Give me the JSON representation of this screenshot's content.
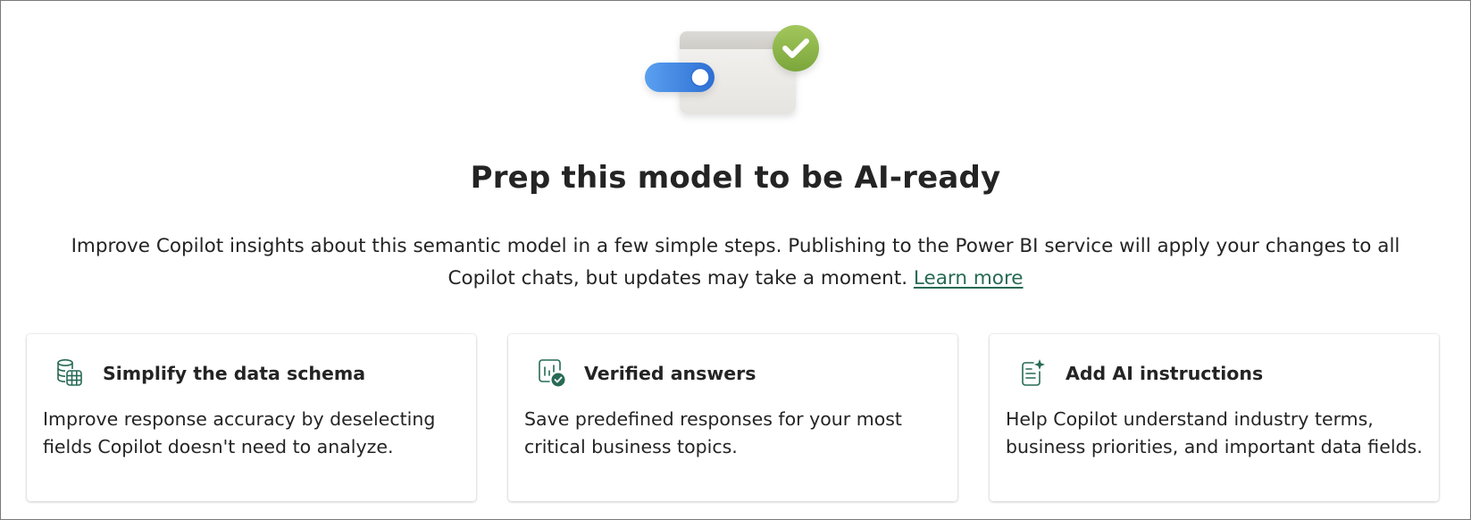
{
  "page": {
    "title": "Prep this model to be AI-ready",
    "description": "Improve Copilot insights about this semantic model in a few simple steps. Publishing to the Power BI service will apply your changes to all Copilot chats, but updates may take a moment.",
    "learn_more": "Learn more"
  },
  "cards": [
    {
      "icon": "table-schema-icon",
      "title": "Simplify the data schema",
      "text": "Improve response accuracy by deselecting fields Copilot doesn't need to analyze."
    },
    {
      "icon": "chart-check-icon",
      "title": "Verified answers",
      "text": "Save predefined responses for your most critical business topics."
    },
    {
      "icon": "document-sparkle-icon",
      "title": "Add AI instructions",
      "text": "Help Copilot understand industry terms, business priorities, and important data fields."
    }
  ],
  "colors": {
    "accent": "#276a55",
    "toggle_blue": "#3f86e0",
    "check_green": "#8db448",
    "text": "#242424"
  }
}
